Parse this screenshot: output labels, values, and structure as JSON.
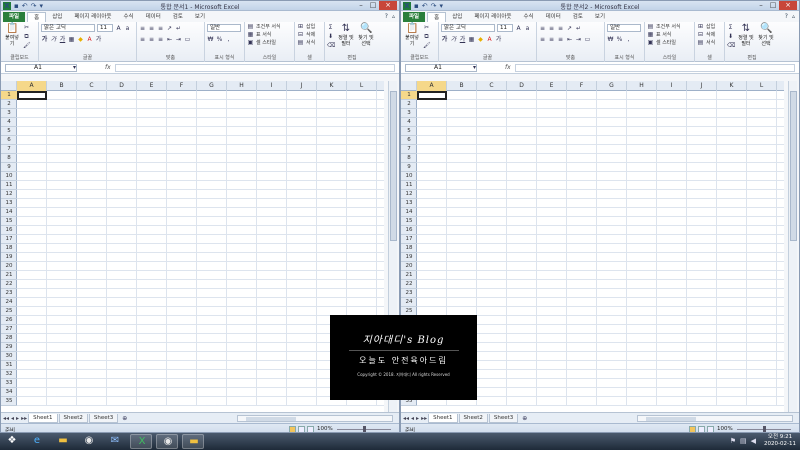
{
  "windows": [
    {
      "title": "통합 문서1 - Microsoft Excel",
      "tabs": [
        "파일",
        "홈",
        "삽입",
        "페이지 레이아웃",
        "수식",
        "데이터",
        "검토",
        "보기"
      ],
      "active_tab": 1,
      "ribbon": {
        "clipboard": {
          "paste": "붙여넣기",
          "label": "클립보드"
        },
        "font": {
          "font_name": "맑은 고딕",
          "font_size": "11",
          "bold": "가",
          "italic": "가",
          "underline": "가",
          "label": "글꼴"
        },
        "alignment": {
          "label": "맞춤"
        },
        "number": {
          "format": "일반",
          "percent": "%",
          "label": "표시 형식"
        },
        "styles": {
          "conditional": "조건부 서식",
          "table": "표 서식",
          "cell": "셀 스타일",
          "label": "스타일"
        },
        "cells": {
          "insert": "삽입",
          "delete": "삭제",
          "format": "서식",
          "label": "셀"
        },
        "editing": {
          "sigma": "Σ",
          "sort": "정렬 및 필터",
          "find": "찾기 및 선택",
          "label": "편집"
        }
      },
      "name_box": "A1",
      "fx": "fx",
      "columns": [
        "A",
        "B",
        "C",
        "D",
        "E",
        "F",
        "G",
        "H",
        "I",
        "J",
        "K",
        "L"
      ],
      "rows": [
        "1",
        "2",
        "3",
        "4",
        "5",
        "6",
        "7",
        "8",
        "9",
        "10",
        "11",
        "12",
        "13",
        "14",
        "15",
        "16",
        "17",
        "18",
        "19",
        "20",
        "21",
        "22",
        "23",
        "24",
        "25",
        "26",
        "27",
        "28",
        "29",
        "30",
        "31",
        "32",
        "33",
        "34",
        "35"
      ],
      "sheets": [
        "Sheet1",
        "Sheet2",
        "Sheet3"
      ],
      "status": "준비",
      "zoom": "100%"
    },
    {
      "title": "통합 문서2 - Microsoft Excel",
      "tabs": [
        "파일",
        "홈",
        "삽입",
        "페이지 레이아웃",
        "수식",
        "데이터",
        "검토",
        "보기"
      ],
      "active_tab": 1,
      "ribbon": {
        "clipboard": {
          "paste": "붙여넣기",
          "label": "클립보드"
        },
        "font": {
          "font_name": "맑은 고딕",
          "font_size": "11",
          "bold": "가",
          "italic": "가",
          "underline": "가",
          "label": "글꼴"
        },
        "alignment": {
          "label": "맞춤"
        },
        "number": {
          "format": "일반",
          "percent": "%",
          "label": "표시 형식"
        },
        "styles": {
          "conditional": "조건부 서식",
          "table": "표 서식",
          "cell": "셀 스타일",
          "label": "스타일"
        },
        "cells": {
          "insert": "삽입",
          "delete": "삭제",
          "format": "서식",
          "label": "셀"
        },
        "editing": {
          "sigma": "Σ",
          "sort": "정렬 및 필터",
          "find": "찾기 및 선택",
          "label": "편집"
        }
      },
      "name_box": "A1",
      "fx": "fx",
      "columns": [
        "A",
        "B",
        "C",
        "D",
        "E",
        "F",
        "G",
        "H",
        "I",
        "J",
        "K",
        "L"
      ],
      "rows": [
        "1",
        "2",
        "3",
        "4",
        "5",
        "6",
        "7",
        "8",
        "9",
        "10",
        "11",
        "12",
        "13",
        "14",
        "15",
        "16",
        "17",
        "18",
        "19",
        "20",
        "21",
        "22",
        "23",
        "24",
        "25",
        "26",
        "27",
        "28",
        "29",
        "30",
        "31",
        "32",
        "33",
        "34",
        "35"
      ],
      "sheets": [
        "Sheet1",
        "Sheet2",
        "Sheet3"
      ],
      "status": "준비",
      "zoom": "100%"
    }
  ],
  "overlay": {
    "title": "지아대디's Blog",
    "subtitle": "오늘도 안전육아드림",
    "copyright": "Copyright © 2018. 지아대디 All rights Reserved"
  },
  "taskbar": {
    "apps": [
      "ie-icon",
      "folder-icon",
      "chrome-icon",
      "outlook-icon",
      "excel-icon",
      "chrome-icon",
      "folder-icon"
    ],
    "time": "오전 9:21",
    "date": "2020-02-11"
  },
  "colors": {
    "file_tab": "#2a7f3b",
    "active_cell_header": "#f5d88a",
    "taskbar": "#1e2a38"
  }
}
